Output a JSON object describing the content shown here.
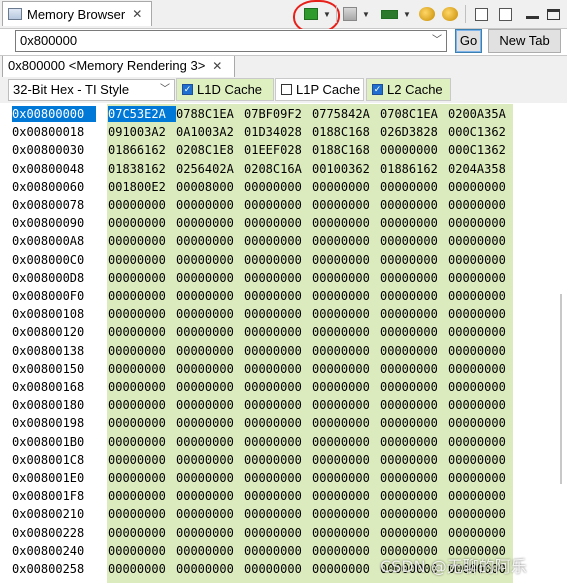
{
  "view": {
    "title": "Memory Browser",
    "close_glyph": "✕"
  },
  "toolbar": {
    "icons": [
      "refresh-chip-icon",
      "graph-icon",
      "memory-chip-icon",
      "import-icon",
      "export-icon",
      "new-window-icon",
      "pin-icon",
      "minimize-icon",
      "maximize-icon"
    ]
  },
  "address": {
    "value": "0x800000",
    "go_label": "Go",
    "new_tab_label": "New Tab"
  },
  "rendering_tab": {
    "label": "0x800000 <Memory Rendering 3>",
    "close_glyph": "✕"
  },
  "format": {
    "selected": "32-Bit Hex - TI Style"
  },
  "caches": [
    {
      "label": "L1D Cache",
      "checked": true
    },
    {
      "label": "L1P Cache",
      "checked": false
    },
    {
      "label": "L2 Cache",
      "checked": true
    }
  ],
  "memory": {
    "rows": [
      {
        "addr": "0x00800000",
        "cells": [
          "07C53E2A",
          "0788C1EA",
          "07BF09F2",
          "0775842A",
          "0708C1EA",
          "0200A35A"
        ]
      },
      {
        "addr": "0x00800018",
        "cells": [
          "091003A2",
          "0A1003A2",
          "01D34028",
          "0188C168",
          "026D3828",
          "000C1362"
        ]
      },
      {
        "addr": "0x00800030",
        "cells": [
          "01866162",
          "0208C1E8",
          "01EEF028",
          "0188C168",
          "00000000",
          "000C1362"
        ]
      },
      {
        "addr": "0x00800048",
        "cells": [
          "01838162",
          "0256402A",
          "0208C16A",
          "00100362",
          "01886162",
          "0204A358"
        ]
      },
      {
        "addr": "0x00800060",
        "cells": [
          "001800E2",
          "00008000",
          "00000000",
          "00000000",
          "00000000",
          "00000000"
        ]
      },
      {
        "addr": "0x00800078",
        "cells": [
          "00000000",
          "00000000",
          "00000000",
          "00000000",
          "00000000",
          "00000000"
        ]
      },
      {
        "addr": "0x00800090",
        "cells": [
          "00000000",
          "00000000",
          "00000000",
          "00000000",
          "00000000",
          "00000000"
        ]
      },
      {
        "addr": "0x008000A8",
        "cells": [
          "00000000",
          "00000000",
          "00000000",
          "00000000",
          "00000000",
          "00000000"
        ]
      },
      {
        "addr": "0x008000C0",
        "cells": [
          "00000000",
          "00000000",
          "00000000",
          "00000000",
          "00000000",
          "00000000"
        ]
      },
      {
        "addr": "0x008000D8",
        "cells": [
          "00000000",
          "00000000",
          "00000000",
          "00000000",
          "00000000",
          "00000000"
        ]
      },
      {
        "addr": "0x008000F0",
        "cells": [
          "00000000",
          "00000000",
          "00000000",
          "00000000",
          "00000000",
          "00000000"
        ]
      },
      {
        "addr": "0x00800108",
        "cells": [
          "00000000",
          "00000000",
          "00000000",
          "00000000",
          "00000000",
          "00000000"
        ]
      },
      {
        "addr": "0x00800120",
        "cells": [
          "00000000",
          "00000000",
          "00000000",
          "00000000",
          "00000000",
          "00000000"
        ]
      },
      {
        "addr": "0x00800138",
        "cells": [
          "00000000",
          "00000000",
          "00000000",
          "00000000",
          "00000000",
          "00000000"
        ]
      },
      {
        "addr": "0x00800150",
        "cells": [
          "00000000",
          "00000000",
          "00000000",
          "00000000",
          "00000000",
          "00000000"
        ]
      },
      {
        "addr": "0x00800168",
        "cells": [
          "00000000",
          "00000000",
          "00000000",
          "00000000",
          "00000000",
          "00000000"
        ]
      },
      {
        "addr": "0x00800180",
        "cells": [
          "00000000",
          "00000000",
          "00000000",
          "00000000",
          "00000000",
          "00000000"
        ]
      },
      {
        "addr": "0x00800198",
        "cells": [
          "00000000",
          "00000000",
          "00000000",
          "00000000",
          "00000000",
          "00000000"
        ]
      },
      {
        "addr": "0x008001B0",
        "cells": [
          "00000000",
          "00000000",
          "00000000",
          "00000000",
          "00000000",
          "00000000"
        ]
      },
      {
        "addr": "0x008001C8",
        "cells": [
          "00000000",
          "00000000",
          "00000000",
          "00000000",
          "00000000",
          "00000000"
        ]
      },
      {
        "addr": "0x008001E0",
        "cells": [
          "00000000",
          "00000000",
          "00000000",
          "00000000",
          "00000000",
          "00000000"
        ]
      },
      {
        "addr": "0x008001F8",
        "cells": [
          "00000000",
          "00000000",
          "00000000",
          "00000000",
          "00000000",
          "00000000"
        ]
      },
      {
        "addr": "0x00800210",
        "cells": [
          "00000000",
          "00000000",
          "00000000",
          "00000000",
          "00000000",
          "00000000"
        ]
      },
      {
        "addr": "0x00800228",
        "cells": [
          "00000000",
          "00000000",
          "00000000",
          "00000000",
          "00000000",
          "00000000"
        ]
      },
      {
        "addr": "0x00800240",
        "cells": [
          "00000000",
          "00000000",
          "00000000",
          "00000000",
          "00000000",
          "00000000"
        ]
      },
      {
        "addr": "0x00800258",
        "cells": [
          "00000000",
          "00000000",
          "00000000",
          "00000000",
          "00000000",
          "00000000"
        ]
      }
    ]
  },
  "watermark": "CSDN @无聊的阿乐",
  "colors": {
    "selection": "#0078d7",
    "cache_highlight": "#dcebbe",
    "annotation_ring": "#e8201a"
  }
}
